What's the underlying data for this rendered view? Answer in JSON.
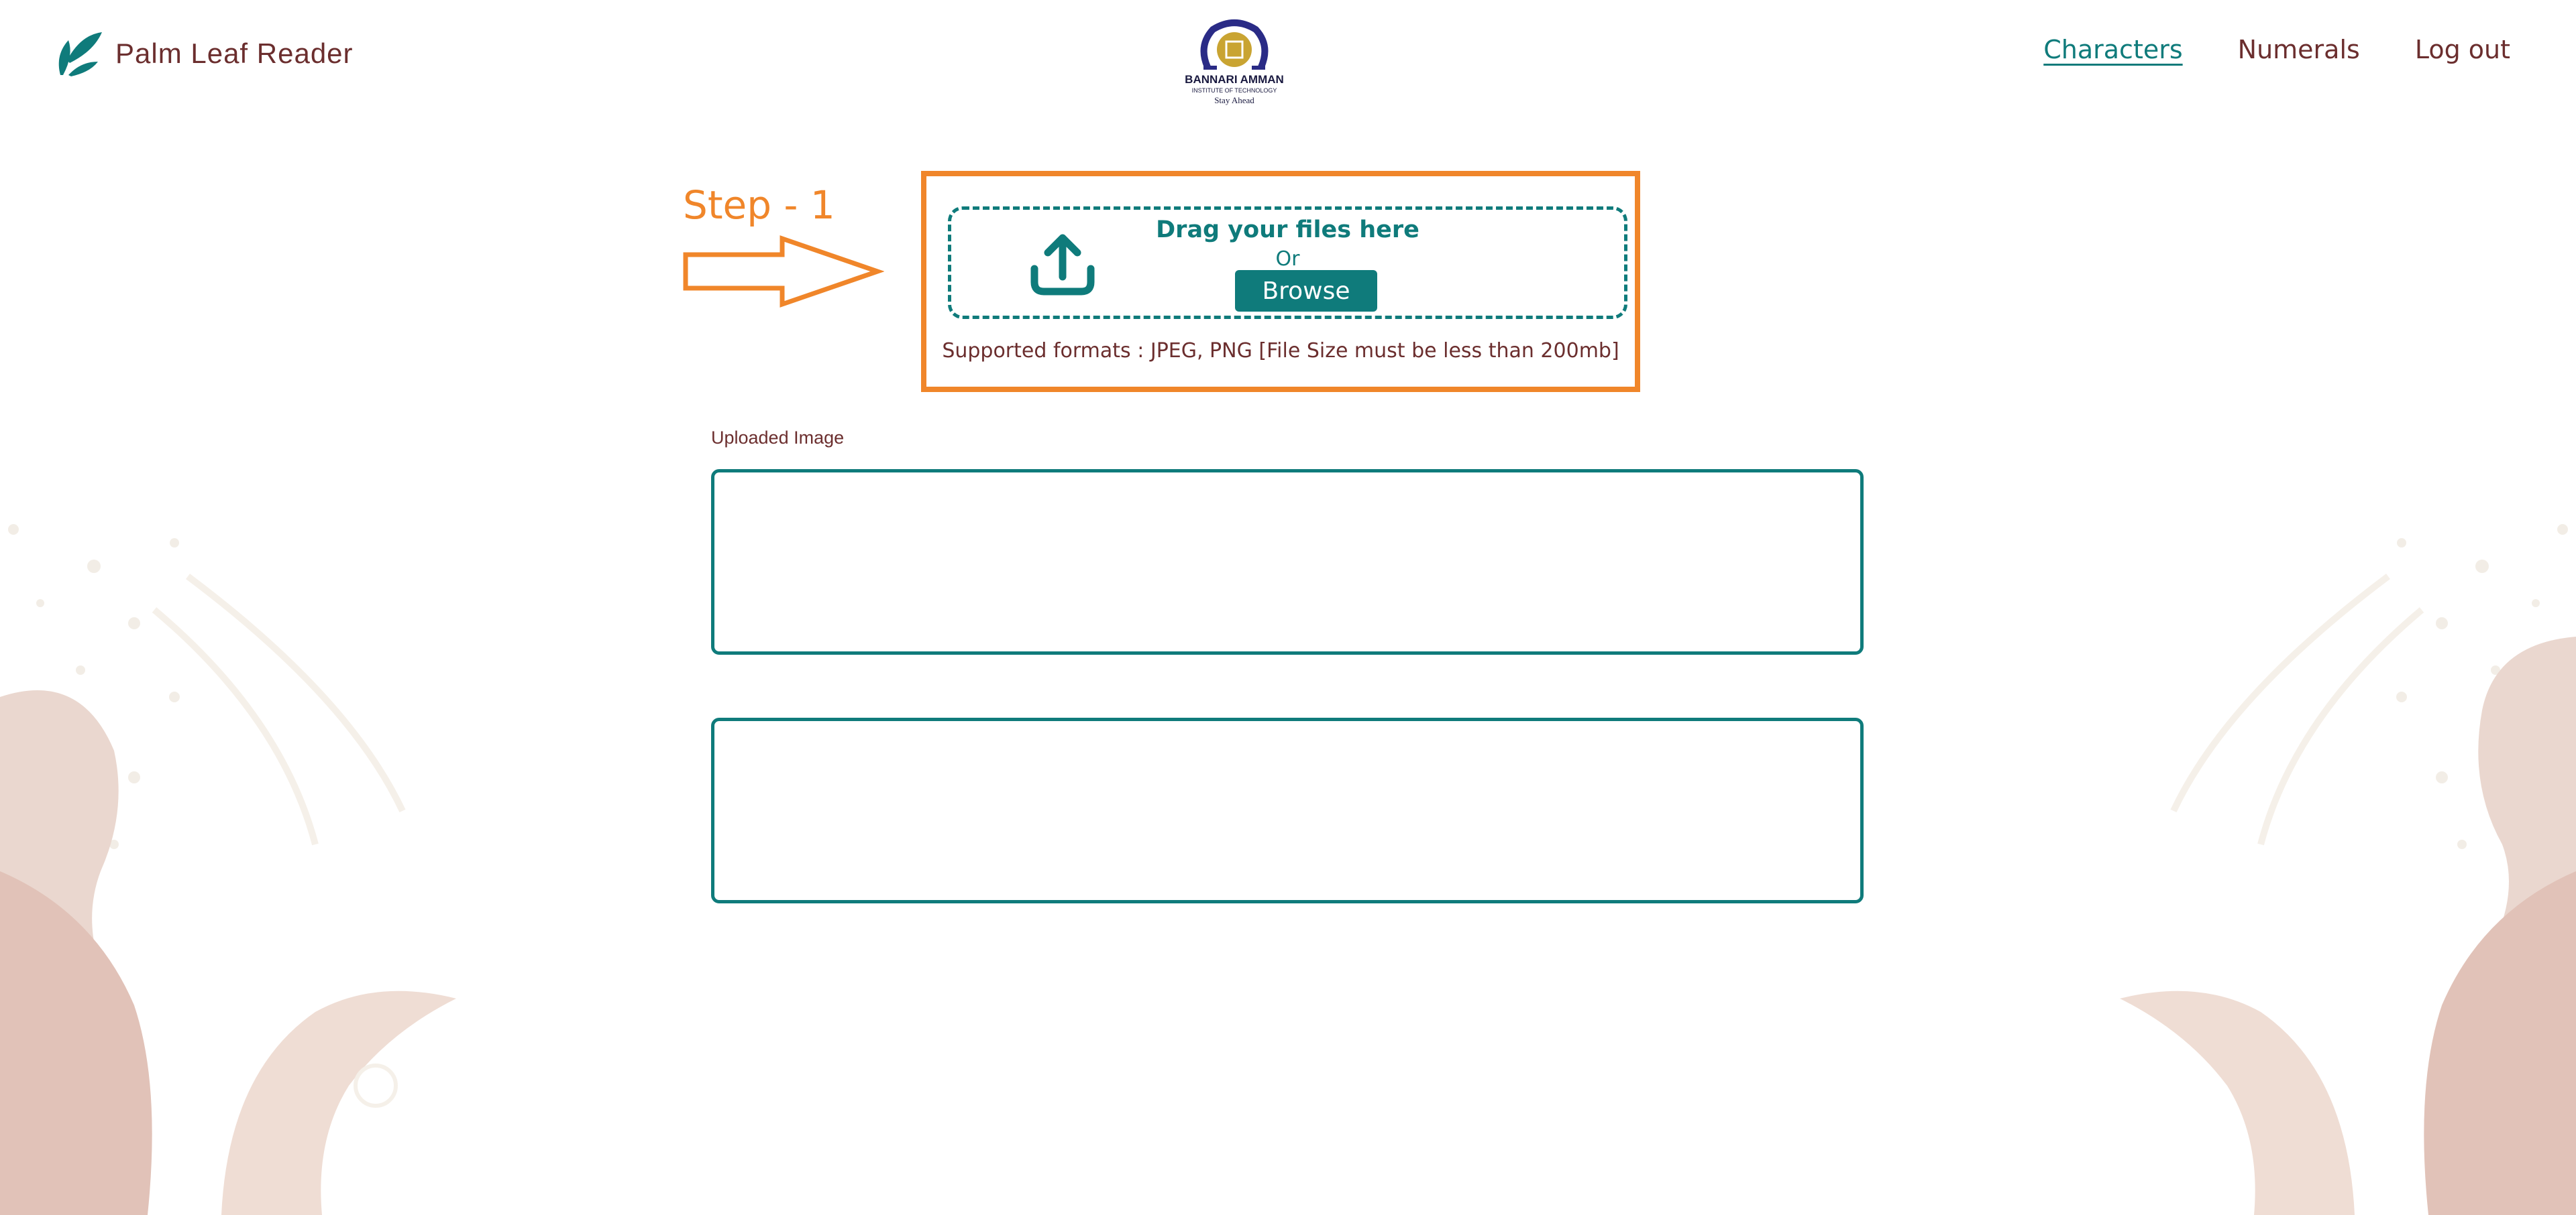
{
  "app": {
    "name": "Palm Leaf Reader"
  },
  "logo": {
    "line1": "BANNARI AMMAN",
    "line2": "INSTITUTE OF TECHNOLOGY",
    "tagline": "Stay Ahead"
  },
  "nav": {
    "items": [
      {
        "label": "Characters",
        "active": true
      },
      {
        "label": "Numerals",
        "active": false
      },
      {
        "label": "Log out",
        "active": false
      }
    ]
  },
  "annotation": {
    "step": "Step - 1"
  },
  "upload": {
    "title": "Drag your files here",
    "or": "Or",
    "browse_label": "Browse",
    "formats": "Supported formats : JPEG, PNG [File Size must be less than 200mb]",
    "icon": "upload-icon"
  },
  "results": {
    "uploaded_label": "Uploaded Image"
  },
  "colors": {
    "accent": "#0f7b7b",
    "brand_text": "#6b2e2e",
    "highlight": "#f0862a"
  }
}
